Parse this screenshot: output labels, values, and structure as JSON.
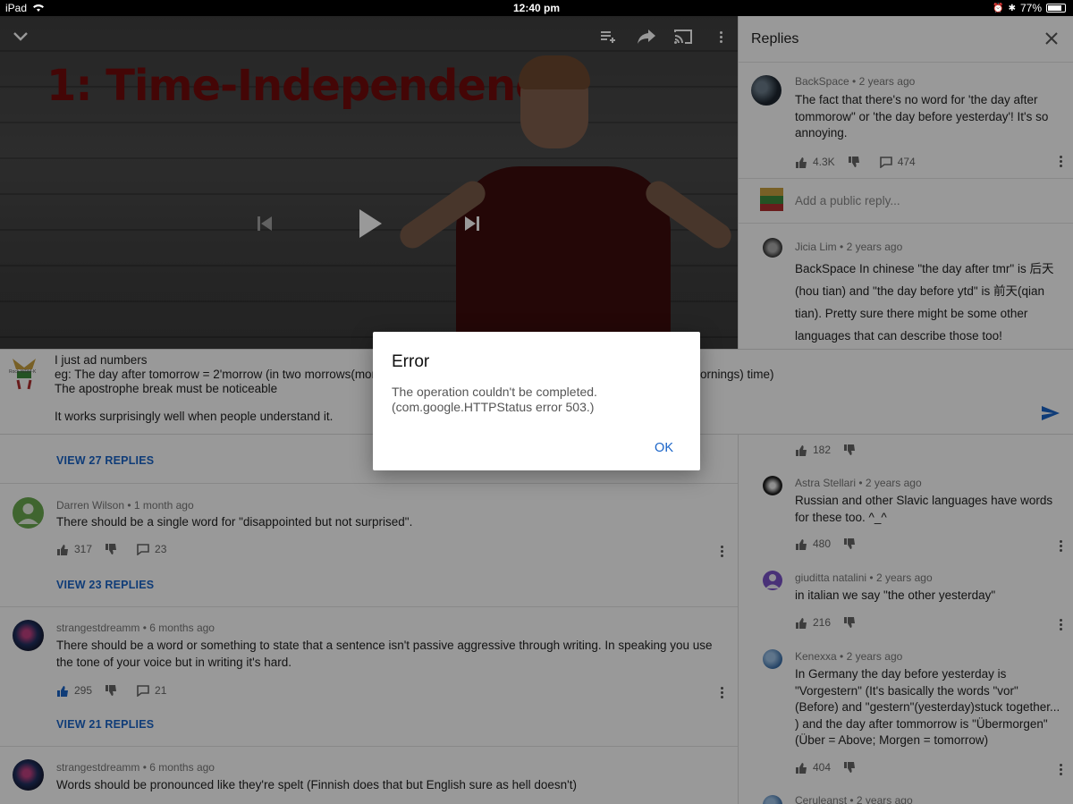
{
  "status": {
    "device": "iPad",
    "time": "12:40 pm",
    "battery": "77%"
  },
  "video": {
    "slide_title": "1: Time-Independence"
  },
  "replies_panel": {
    "title": "Replies",
    "parent": {
      "author": "BackSpace",
      "age": "2 years ago",
      "text": "The fact that there's no word for 'the day after tommorow\" or 'the day before yesterday'! It's so annoying.",
      "likes": "4.3K",
      "reply_count": "474"
    },
    "add_reply_placeholder": "Add a public reply...",
    "items": [
      {
        "author": "Jicia Lim",
        "age": "2 years ago",
        "text": "BackSpace In chinese \"the day after tmr\" is 后天 (hou tian) and \"the day before ytd\" is 前天(qian tian). Pretty sure there might be some other languages that can describe those too!",
        "likes": "182"
      },
      {
        "author": "Astra Stellari",
        "age": "2 years ago",
        "text": "Russian and other Slavic languages have words for these too. ^_^",
        "likes": "480"
      },
      {
        "author": "giuditta natalini",
        "age": "2 years ago",
        "text": "in italian we say \"the other yesterday\"",
        "likes": "216"
      },
      {
        "author": "Kenexxa",
        "age": "2 years ago",
        "text": "In Germany the day before yesterday is \"Vorgestern\" (It's basically the words \"vor\" (Before) and \"gestern\"(yesterday)stuck together... ) and the day after tommorrow is \"Übermorgen\"(Über = Above; Morgen = tomorrow)",
        "likes": "404"
      },
      {
        "author": "Ceruleanst",
        "age": "2 years ago"
      }
    ]
  },
  "compose": {
    "line1": "I just ad numbers",
    "line2": "eg: The day after tomorrow = 2'morrow (in two morrows(morn",
    "line2_tail": "ornings) time)",
    "line3": "The apostrophe break must be noticeable",
    "line4": "It works surprisingly well when people understand it.",
    "avatar_caption": "Rock WRM-K"
  },
  "comments": [
    {
      "view_replies": "VIEW 27 REPLIES"
    },
    {
      "author": "Darren Wilson",
      "age": "1 month ago",
      "text": "There should be a single word for \"disappointed but not surprised\".",
      "likes": "317",
      "replies": "23",
      "view_replies": "VIEW 23 REPLIES"
    },
    {
      "author": "strangestdreamm",
      "age": "6 months ago",
      "text": "There should be a word or something to state that a sentence isn't passive aggressive through writing. In speaking you use the tone of your voice but in writing it's hard.",
      "likes": "295",
      "replies": "21",
      "view_replies": "VIEW 21 REPLIES"
    },
    {
      "author": "strangestdreamm",
      "age": "6 months ago",
      "text": "Words should be pronounced like they're spelt (Finnish does that but English sure as hell doesn't)"
    }
  ],
  "dialog": {
    "title": "Error",
    "message_line1": "The operation couldn't be completed.",
    "message_line2": "(com.google.HTTPStatus error 503.)",
    "ok": "OK"
  },
  "colors": {
    "accent": "#1a64c8",
    "slide_title": "#b01010",
    "overlay": "rgba(0,0,0,0.4)"
  }
}
